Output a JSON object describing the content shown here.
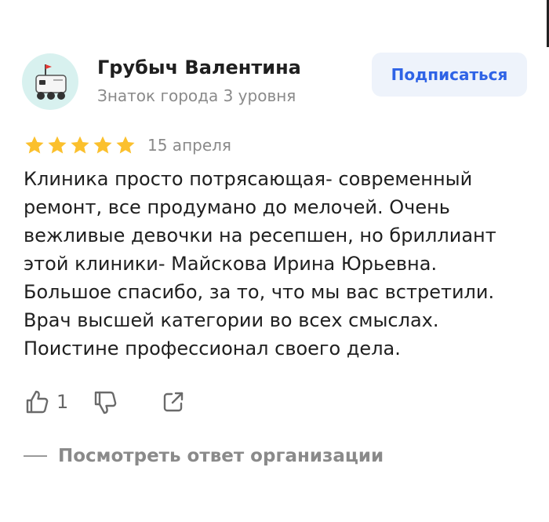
{
  "author": {
    "name": "Грубыч Валентина",
    "level": "Знаток города 3 уровня",
    "avatar_icon": "delivery-robot-icon"
  },
  "subscribe": {
    "label": "Подписаться"
  },
  "review": {
    "rating": 5,
    "rating_max": 5,
    "date": "15 апреля",
    "text": "Клиника просто потрясающая- современный ремонт, все продумано до мелочей. Очень вежливые девочки на ресепшен, но бриллиант этой клиники- Майскова Ирина Юрьевна. Большое спасибо, за то, что мы вас встретили. Врач высшей категории во всех смыслах. Поистине профессионал своего дела."
  },
  "actions": {
    "likes": "1",
    "like_icon": "thumbs-up-icon",
    "dislike_icon": "thumbs-down-icon",
    "share_icon": "share-icon"
  },
  "answer_link": {
    "label": "Посмотреть ответ организации"
  },
  "colors": {
    "star": "#fbc02d",
    "accent": "#2f63e6",
    "muted": "#8a8a8a",
    "avatar_bg": "#d8f1ef"
  }
}
